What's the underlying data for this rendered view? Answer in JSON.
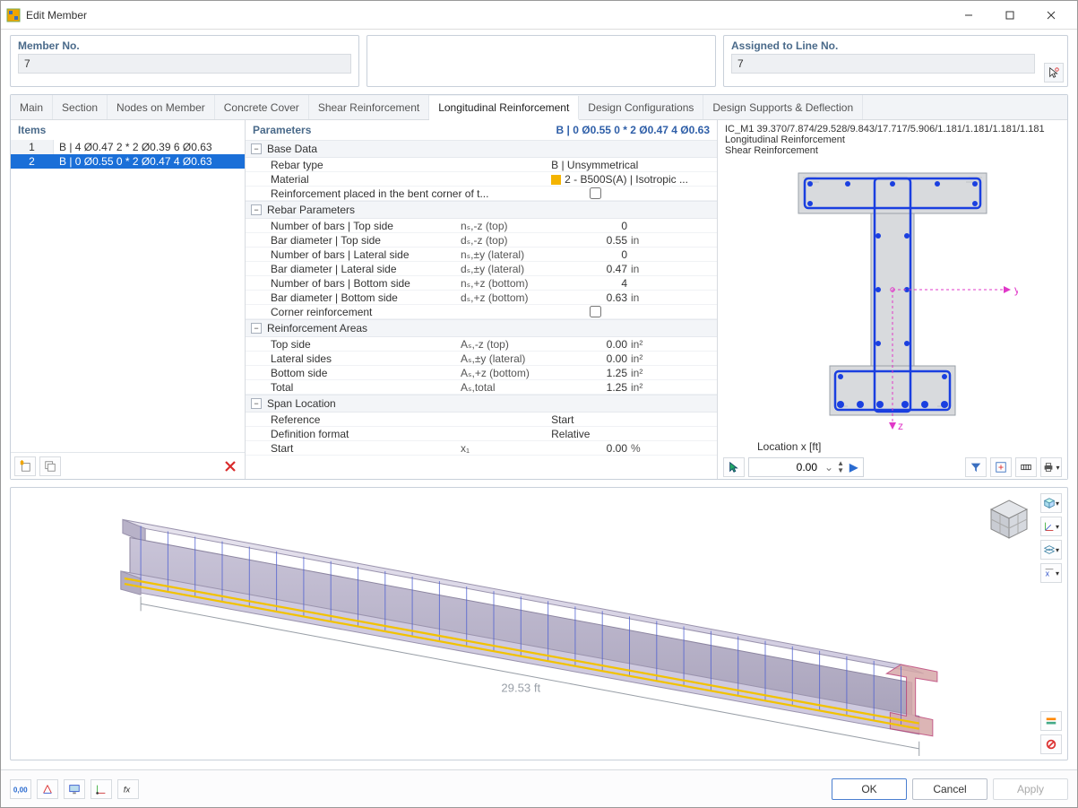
{
  "window": {
    "title": "Edit Member"
  },
  "header": {
    "member_no_label": "Member No.",
    "member_no_value": "7",
    "assigned_label": "Assigned to Line No.",
    "assigned_value": "7"
  },
  "tabs": {
    "main": "Main",
    "section": "Section",
    "nodes": "Nodes on Member",
    "cover": "Concrete Cover",
    "shear": "Shear Reinforcement",
    "long": "Longitudinal Reinforcement",
    "design": "Design Configurations",
    "supports": "Design Supports & Deflection"
  },
  "items": {
    "header": "Items",
    "rows": [
      {
        "idx": "1",
        "text": "B | 4 Ø0.47 2 * 2 Ø0.39 6 Ø0.63"
      },
      {
        "idx": "2",
        "text": "B | 0 Ø0.55 0 * 2 Ø0.47 4 Ø0.63"
      }
    ]
  },
  "params": {
    "header": "Parameters",
    "header_right": "B | 0 Ø0.55 0 * 2 Ø0.47 4 Ø0.63",
    "base": {
      "title": "Base Data",
      "rebar_type_l": "Rebar type",
      "rebar_type_v": "B | Unsymmetrical",
      "material_l": "Material",
      "material_v": "2 - B500S(A) | Isotropic ...",
      "bent_l": "Reinforcement placed in the bent corner of t..."
    },
    "rebar": {
      "title": "Rebar Parameters",
      "r1_l": "Number of bars | Top side",
      "r1_s": "nₛ,-z (top)",
      "r1_v": "0",
      "r1_u": "",
      "r2_l": "Bar diameter | Top side",
      "r2_s": "dₛ,-z (top)",
      "r2_v": "0.55",
      "r2_u": "in",
      "r3_l": "Number of bars | Lateral side",
      "r3_s": "nₛ,±y (lateral)",
      "r3_v": "0",
      "r3_u": "",
      "r4_l": "Bar diameter | Lateral side",
      "r4_s": "dₛ,±y (lateral)",
      "r4_v": "0.47",
      "r4_u": "in",
      "r5_l": "Number of bars | Bottom side",
      "r5_s": "nₛ,+z (bottom)",
      "r5_v": "4",
      "r5_u": "",
      "r6_l": "Bar diameter | Bottom side",
      "r6_s": "dₛ,+z (bottom)",
      "r6_v": "0.63",
      "r6_u": "in",
      "r7_l": "Corner reinforcement"
    },
    "areas": {
      "title": "Reinforcement Areas",
      "a1_l": "Top side",
      "a1_s": "Aₛ,-z (top)",
      "a1_v": "0.00",
      "a1_u": "in²",
      "a2_l": "Lateral sides",
      "a2_s": "Aₛ,±y (lateral)",
      "a2_v": "0.00",
      "a2_u": "in²",
      "a3_l": "Bottom side",
      "a3_s": "Aₛ,+z (bottom)",
      "a3_v": "1.25",
      "a3_u": "in²",
      "a4_l": "Total",
      "a4_s": "Aₛ,total",
      "a4_v": "1.25",
      "a4_u": "in²"
    },
    "span": {
      "title": "Span Location",
      "s1_l": "Reference",
      "s1_v": "Start",
      "s2_l": "Definition format",
      "s2_v": "Relative",
      "s3_l": "Start",
      "s3_s": "x₁",
      "s3_v": "0.00",
      "s3_u": "%"
    }
  },
  "preview": {
    "line1": "IC_M1 39.370/7.874/29.528/9.843/17.717/5.906/1.181/1.181/1.181/1.181",
    "line2": "Longitudinal Reinforcement",
    "line3": "Shear Reinforcement",
    "loc_label": "Location x [ft]",
    "loc_value": "0.00",
    "axis_y": "y",
    "axis_z": "z"
  },
  "view3d": {
    "dim": "29.53 ft"
  },
  "buttons": {
    "ok": "OK",
    "cancel": "Cancel",
    "apply": "Apply"
  }
}
